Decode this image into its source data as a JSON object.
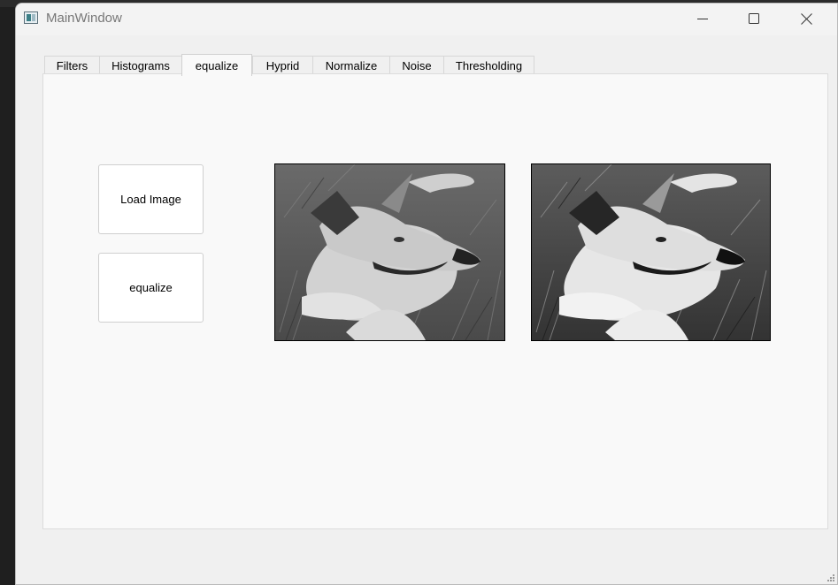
{
  "window": {
    "title": "MainWindow"
  },
  "tabs": [
    {
      "label": "Filters"
    },
    {
      "label": "Histograms"
    },
    {
      "label": "equalize"
    },
    {
      "label": "Hyprid"
    },
    {
      "label": "Normalize"
    },
    {
      "label": "Noise"
    },
    {
      "label": "Thresholding"
    }
  ],
  "active_tab": "equalize",
  "buttons": {
    "load_image": "Load Image",
    "equalize": "equalize"
  },
  "images": {
    "original_alt": "Original grayscale dog image",
    "equalized_alt": "Equalized grayscale dog image"
  }
}
